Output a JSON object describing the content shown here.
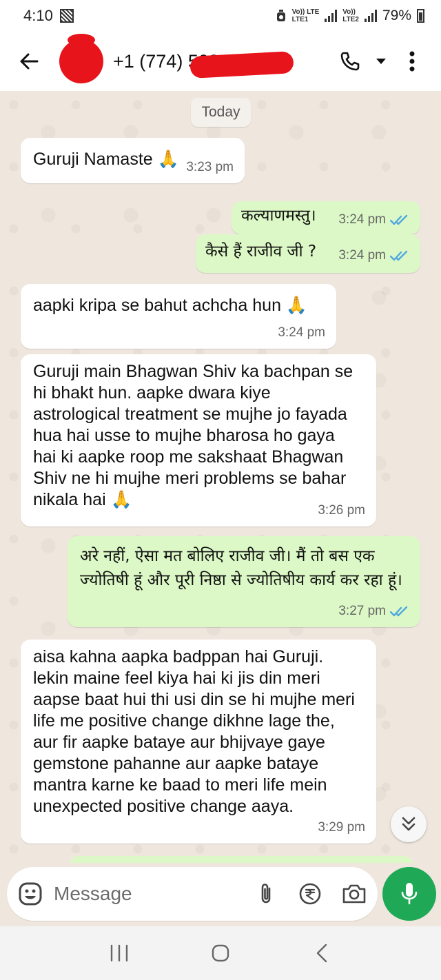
{
  "status_bar": {
    "time": "4:10",
    "sim1_label": "Vo)) LTE",
    "sim1_sub": "LTE1",
    "sim2_label": "Vo))",
    "sim2_sub": "LTE2",
    "battery_percent": "79%"
  },
  "header": {
    "contact_name": "+1 (774) 503 0000"
  },
  "chat": {
    "date_chip": "Today",
    "messages": [
      {
        "direction": "in",
        "text": "Guruji Namaste 🙏",
        "time": "3:23 pm"
      },
      {
        "direction": "out",
        "text": "कल्याणमस्तु।",
        "time": "3:24 pm",
        "status": "read"
      },
      {
        "direction": "out",
        "text": "कैसे हैं राजीव जी ?",
        "time": "3:24 pm",
        "status": "read"
      },
      {
        "direction": "in",
        "text": "aapki kripa se bahut achcha hun 🙏",
        "time": "3:24 pm"
      },
      {
        "direction": "in",
        "text": "Guruji main Bhagwan Shiv ka bachpan se hi bhakt hun. aapke dwara kiye astrological treatment se mujhe jo fayada hua hai usse to mujhe bharosa ho gaya hai ki aapke roop me sakshaat Bhagwan Shiv ne hi mujhe meri problems se bahar nikala hai 🙏",
        "time": "3:26 pm"
      },
      {
        "direction": "out",
        "text": "अरे नहीं, ऐसा मत बोलिए राजीव जी। मैं तो बस एक ज्योतिषी हूं और पूरी निष्ठा से ज्योतिषीय कार्य कर रहा हूं।",
        "time": "3:27 pm",
        "status": "read"
      },
      {
        "direction": "in",
        "text": "aisa kahna aapka badppan hai Guruji. lekin maine feel kiya hai ki jis din meri aapse baat hui thi usi din se hi mujhe meri life me positive change dikhne lage the, aur fir aapke bataye aur bhijvaye gaye gemstone pahanne aur aapke bataye mantra karne ke baad to meri life mein unexpected positive change aaya.",
        "time": "3:29 pm"
      }
    ]
  },
  "composer": {
    "placeholder": "Message"
  },
  "colors": {
    "incoming_bubble": "#ffffff",
    "outgoing_bubble": "#dcf8c6",
    "read_tick": "#4fa8e0",
    "mic_button": "#1fa855",
    "chat_background": "#efe7de"
  },
  "icons": {
    "back": "arrow-left-icon",
    "call": "phone-icon",
    "dropdown": "caret-down-icon",
    "menu": "more-vertical-icon",
    "emoji": "emoji-icon",
    "attach": "paperclip-icon",
    "payment": "rupee-icon",
    "camera": "camera-icon",
    "mic": "mic-icon",
    "scroll": "double-chevron-down-icon"
  }
}
